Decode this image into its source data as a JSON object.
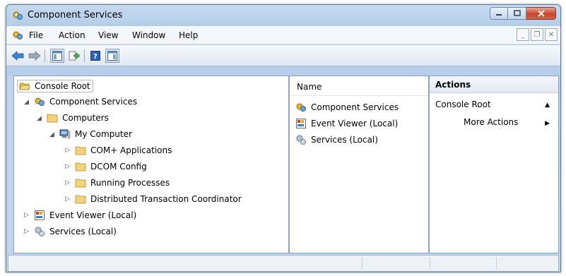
{
  "window": {
    "title": "Component Services"
  },
  "menu": [
    {
      "label": "File"
    },
    {
      "label": "Action"
    },
    {
      "label": "View"
    },
    {
      "label": "Window"
    },
    {
      "label": "Help"
    }
  ],
  "toolbar": {
    "back": "back-icon",
    "forward": "forward-icon",
    "console_tree": "console-tree-icon",
    "export": "export-list-icon",
    "help": "help-icon",
    "action_pane": "action-pane-icon"
  },
  "tree": {
    "root": "Console Root",
    "items": [
      {
        "label": "Component Services",
        "state": "expanded"
      },
      {
        "label": "Computers",
        "state": "expanded"
      },
      {
        "label": "My Computer",
        "state": "expanded"
      },
      {
        "label": "COM+ Applications",
        "state": "collapsed"
      },
      {
        "label": "DCOM Config",
        "state": "collapsed"
      },
      {
        "label": "Running Processes",
        "state": "collapsed"
      },
      {
        "label": "Distributed Transaction Coordinator",
        "state": "collapsed"
      },
      {
        "label": "Event Viewer (Local)",
        "state": "collapsed"
      },
      {
        "label": "Services (Local)",
        "state": "collapsed"
      }
    ]
  },
  "list": {
    "column": "Name",
    "items": [
      {
        "label": "Component Services"
      },
      {
        "label": "Event Viewer (Local)"
      },
      {
        "label": "Services (Local)"
      }
    ]
  },
  "actions": {
    "title": "Actions",
    "section": "Console Root",
    "more": "More Actions"
  },
  "colors": {
    "accent": "#c2d4e9",
    "close": "#c8442a"
  }
}
